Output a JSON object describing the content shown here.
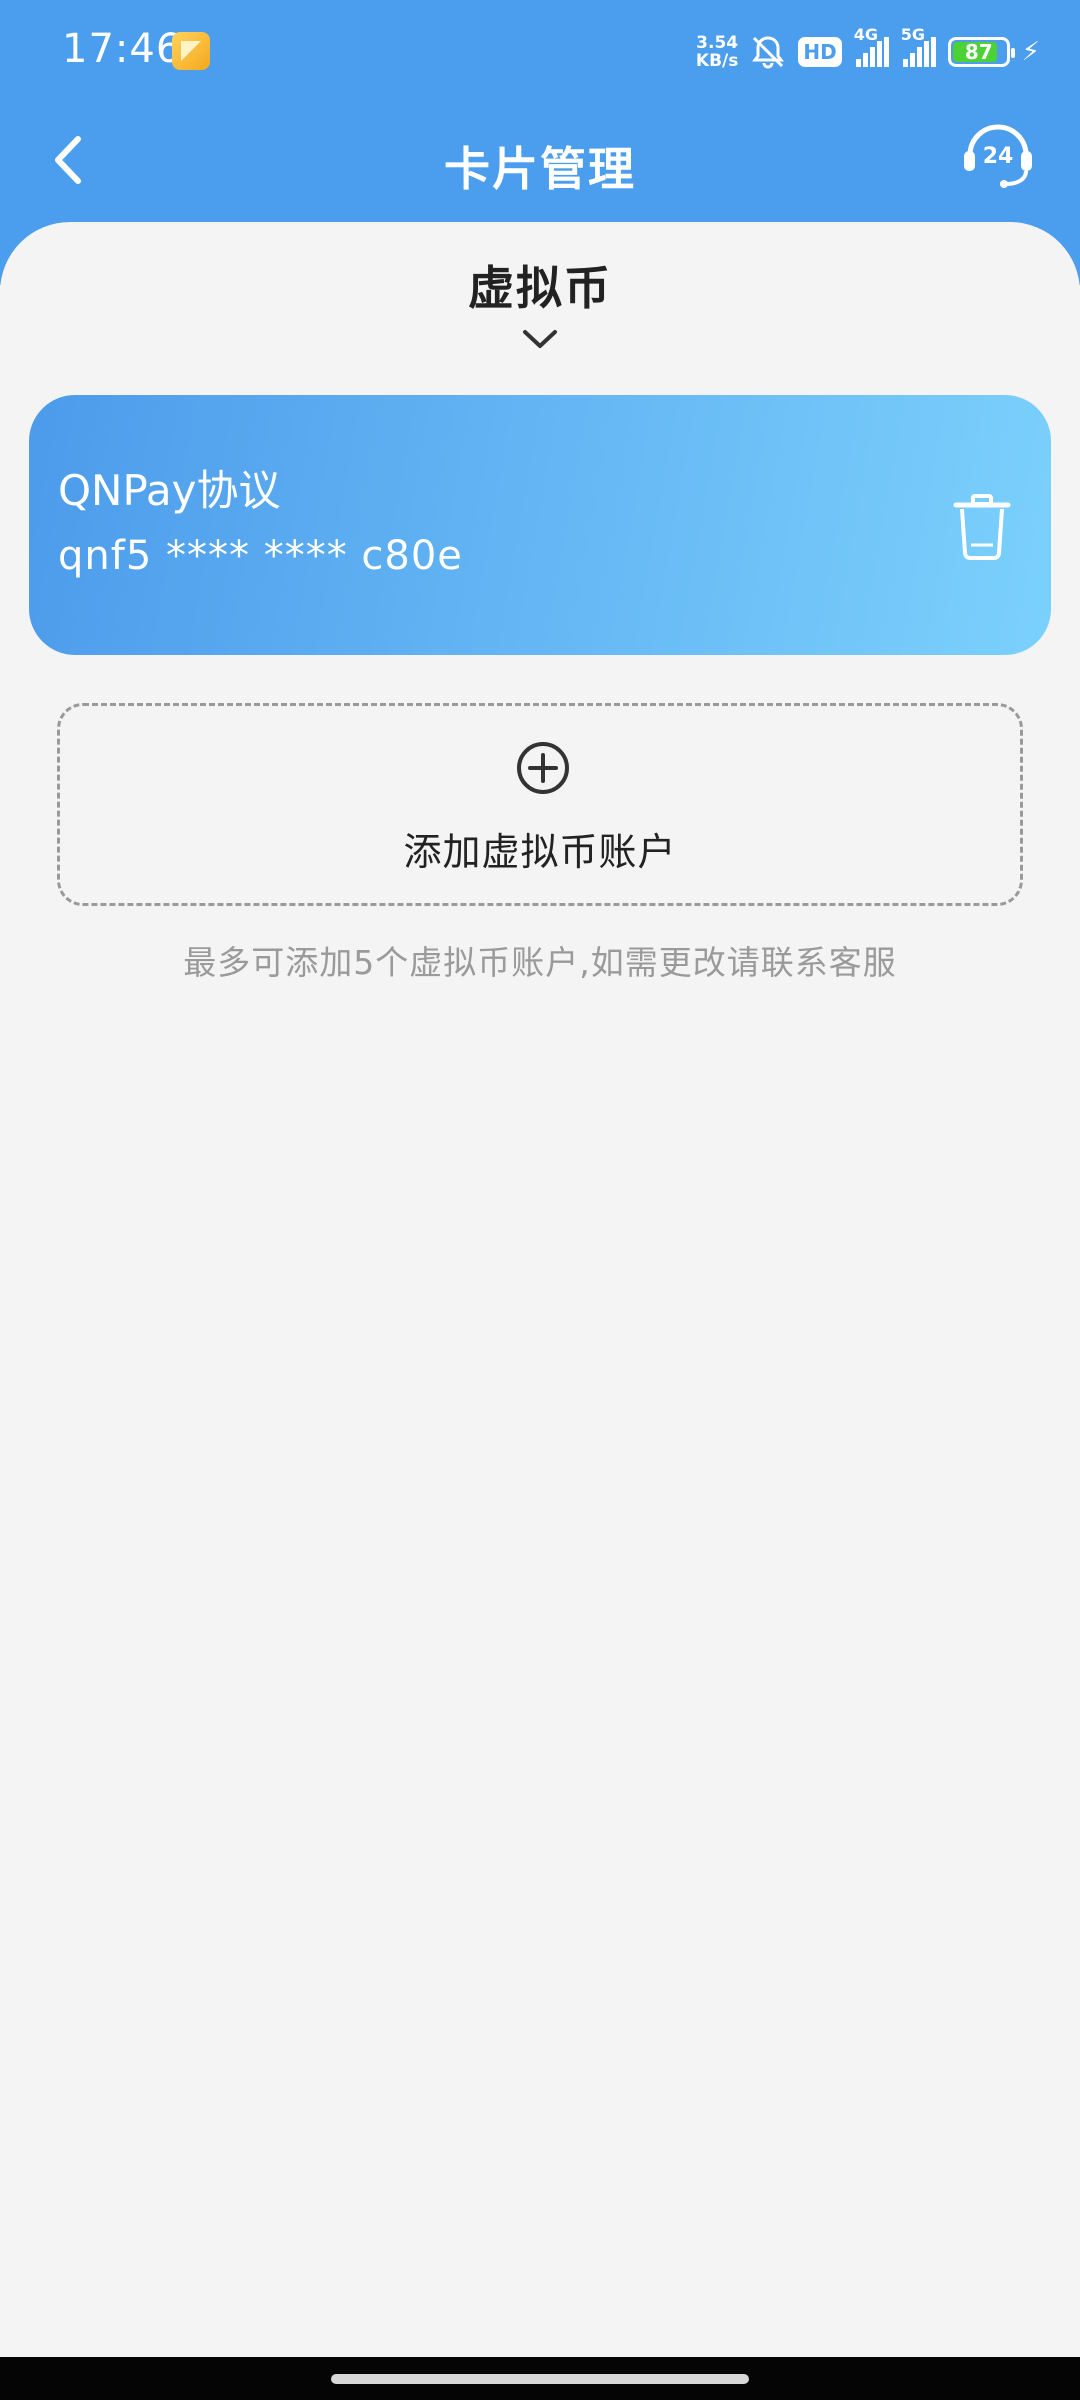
{
  "status_bar": {
    "time": "17:46",
    "net_speed_value": "3.54",
    "net_speed_unit": "KB/s",
    "hd_badge": "HD",
    "signal_1_label": "4G",
    "signal_2_label": "5G",
    "battery_level": "87",
    "battery_color": "#4cd137"
  },
  "nav": {
    "title": "卡片管理",
    "back_icon": "chevron-left-icon",
    "support_icon": "headset-24-icon",
    "support_badge": "24"
  },
  "selector": {
    "title": "虚拟币",
    "icon": "chevron-down-icon"
  },
  "card": {
    "name": "QNPay协议",
    "number": "qnf5 **** **** c80e",
    "delete_icon": "trash-icon",
    "gradient_start": "#4c9beb",
    "gradient_end": "#7bd1fc"
  },
  "add_account": {
    "icon": "plus-circle-icon",
    "label": "添加虚拟币账户"
  },
  "hint": "最多可添加5个虚拟币账户,如需更改请联系客服",
  "colors": {
    "header": "#4b9ded",
    "background": "#f4f4f5",
    "hint_text": "#9a9a9a"
  }
}
